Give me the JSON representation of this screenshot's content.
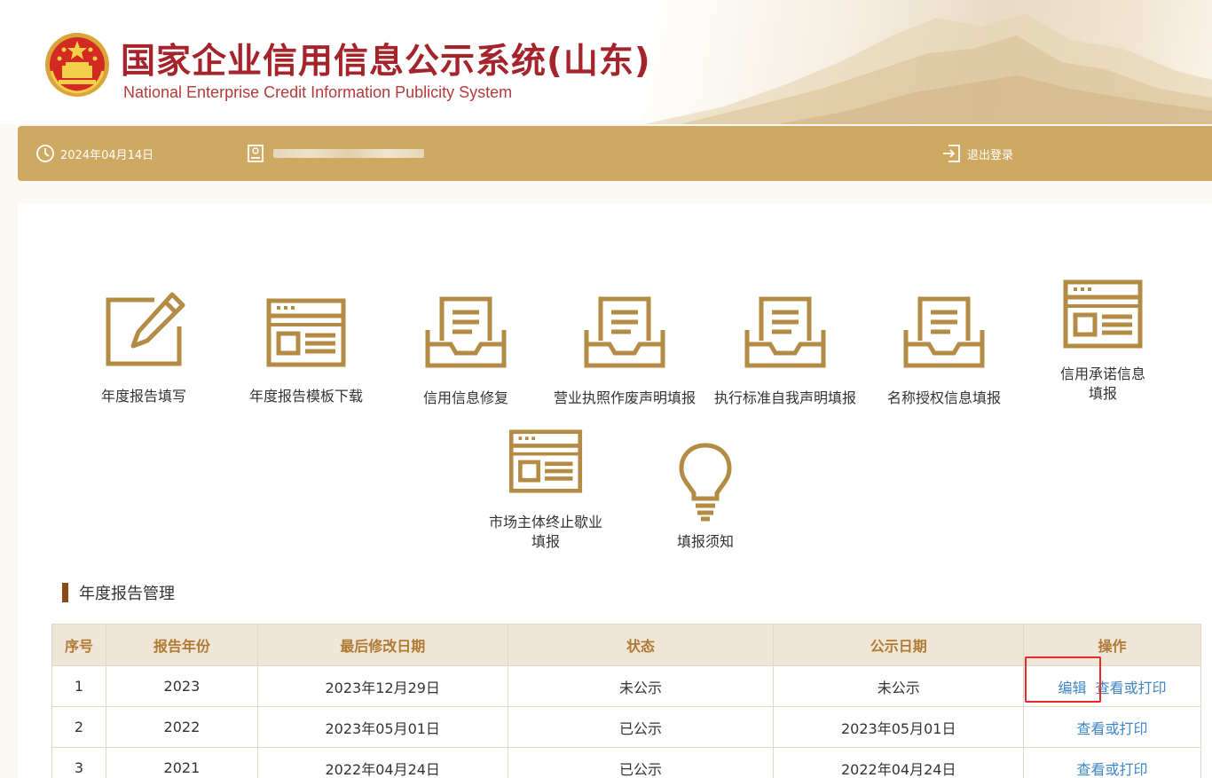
{
  "header": {
    "title_cn": "国家企业信用信息公示系统(山东)",
    "title_en": "National Enterprise Credit Information Publicity System"
  },
  "toolbar": {
    "date": "2024年04月14日",
    "logout": "退出登录"
  },
  "tiles": [
    {
      "label": "年度报告填写",
      "icon": "edit-form-icon"
    },
    {
      "label": "年度报告模板下载",
      "icon": "document-window-icon"
    },
    {
      "label": "信用信息修复",
      "icon": "inbox-document-icon"
    },
    {
      "label": "营业执照作废声明填报",
      "icon": "inbox-document-icon"
    },
    {
      "label": "执行标准自我声明填报",
      "icon": "inbox-document-icon"
    },
    {
      "label": "名称授权信息填报",
      "icon": "inbox-document-icon"
    },
    {
      "label_line1": "信用承诺信息",
      "label_line2": "填报",
      "icon": "document-window-icon"
    },
    {
      "label_line1": "市场主体终止歇业",
      "label_line2": "填报",
      "icon": "document-window-icon"
    },
    {
      "label": "填报须知",
      "icon": "lightbulb-icon"
    }
  ],
  "section": {
    "title": "年度报告管理"
  },
  "table": {
    "headers": [
      "序号",
      "报告年份",
      "最后修改日期",
      "状态",
      "公示日期",
      "操作"
    ],
    "rows": [
      {
        "no": "1",
        "year": "2023",
        "modified": "2023年12月29日",
        "status": "未公示",
        "publish": "未公示",
        "actions": [
          "编辑",
          "查看或打印"
        ]
      },
      {
        "no": "2",
        "year": "2022",
        "modified": "2023年05月01日",
        "status": "已公示",
        "publish": "2023年05月01日",
        "actions": [
          "查看或打印"
        ]
      },
      {
        "no": "3",
        "year": "2021",
        "modified": "2022年04月24日",
        "status": "已公示",
        "publish": "2022年04月24日",
        "actions": [
          "查看或打印"
        ]
      }
    ]
  },
  "colors": {
    "gold": "#cfa862",
    "icon_brown": "#b38b45",
    "title_red": "#a5232b",
    "link_blue": "#3f86c6",
    "highlight_red": "#e22b2b"
  }
}
